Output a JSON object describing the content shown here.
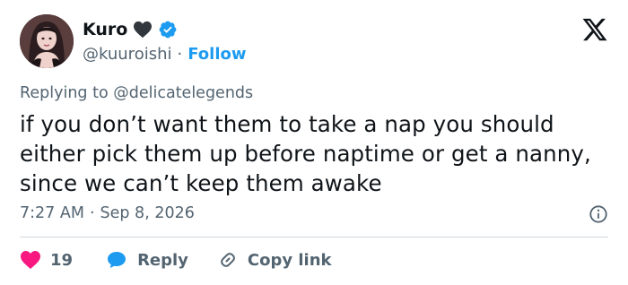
{
  "author": {
    "display_name": "Kuro",
    "handle": "@kuuroishi",
    "follow_label": "Follow",
    "separator": "·"
  },
  "reply_context": {
    "prefix": "Replying to",
    "mention": "@delicatelegends"
  },
  "tweet": {
    "text": "if you don’t want them to take a nap you should either pick them up before naptime or get a nanny, since we can’t keep them awake",
    "time": "7:27 AM",
    "date": "Sep 8, 2026"
  },
  "actions": {
    "like_count": "19",
    "reply_label": "Reply",
    "copy_link_label": "Copy link"
  },
  "colors": {
    "accent": "#1d9bf0",
    "like": "#f91880",
    "text": "#0f1419",
    "muted": "#536471",
    "divider": "#cfd9de"
  },
  "icons": [
    "black-heart-icon",
    "verified-badge-icon",
    "x-logo-icon",
    "info-icon",
    "like-heart-icon",
    "reply-bubble-icon",
    "copy-link-icon"
  ]
}
